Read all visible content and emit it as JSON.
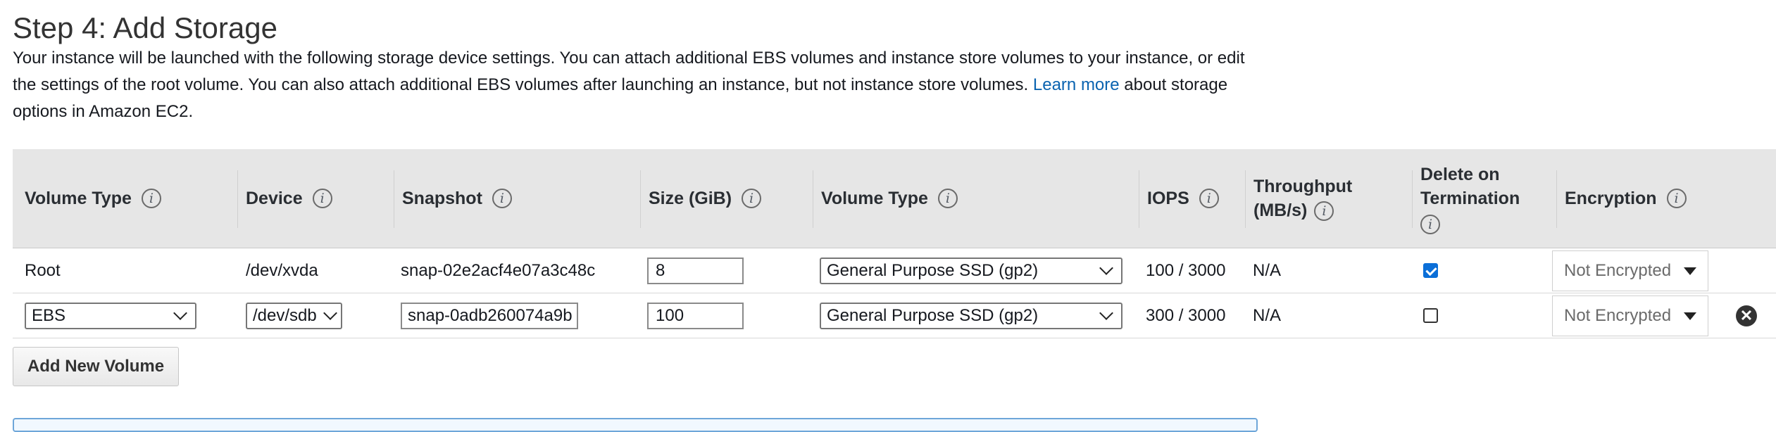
{
  "page": {
    "title": "Step 4: Add Storage",
    "description_before": "Your instance will be launched with the following storage device settings. You can attach additional EBS volumes and instance store volumes to your instance, or edit the settings of the root volume. You can also attach additional EBS volumes after launching an instance, but not instance store volumes. ",
    "learn_more": "Learn more",
    "description_after": " about storage options in Amazon EC2."
  },
  "table": {
    "headers": {
      "volume_type": "Volume Type",
      "device": "Device",
      "snapshot": "Snapshot",
      "size": "Size (GiB)",
      "volume_type2": "Volume Type",
      "iops": "IOPS",
      "throughput": "Throughput (MB/s)",
      "delete_on_termination": "Delete on Termination",
      "encryption": "Encryption"
    },
    "info_glyph": "i",
    "rows": [
      {
        "volume_type": "Root",
        "device": "/dev/xvda",
        "snapshot": "snap-02e2acf4e07a3c48c",
        "size": "8",
        "ebs_volume_type": "General Purpose SSD (gp2)",
        "iops": "100 / 3000",
        "throughput": "N/A",
        "delete_on_termination": true,
        "encryption": "Not Encrypted"
      },
      {
        "volume_type": "EBS",
        "device": "/dev/sdb",
        "snapshot": "snap-0adb260074a9b",
        "size": "100",
        "ebs_volume_type": "General Purpose SSD (gp2)",
        "iops": "300 / 3000",
        "throughput": "N/A",
        "delete_on_termination": false,
        "encryption": "Not Encrypted",
        "remove_glyph": "✕"
      }
    ]
  },
  "buttons": {
    "add_new_volume": "Add New Volume"
  },
  "colors": {
    "link": "#0a63b0",
    "header_bg": "#e6e6e6",
    "checkbox_checked": "#0b6fd8",
    "info_box_border": "#6ea6d9"
  },
  "icons": {
    "info": "info-icon",
    "dropdown": "chevron-down-icon",
    "caret": "caret-down-icon",
    "remove": "close-circle-icon"
  }
}
